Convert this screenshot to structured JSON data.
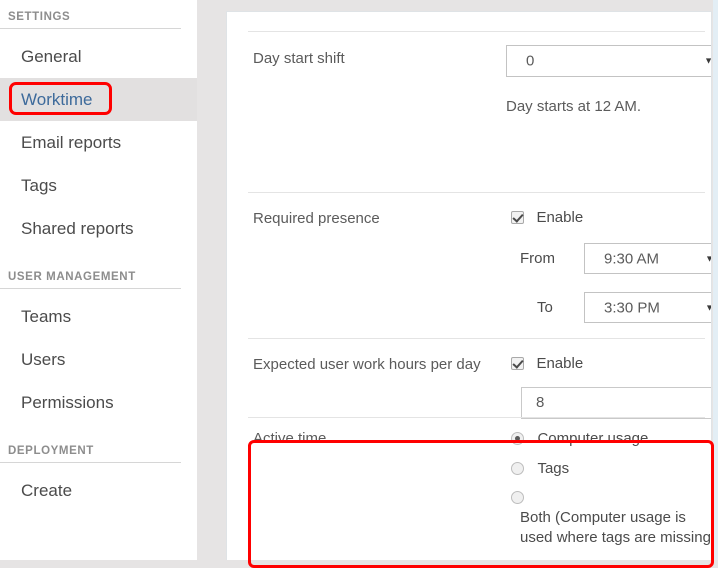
{
  "sidebar": {
    "groups": [
      {
        "title": "SETTINGS",
        "items": [
          {
            "label": "General",
            "active": false
          },
          {
            "label": "Worktime",
            "active": true
          },
          {
            "label": "Email reports",
            "active": false
          },
          {
            "label": "Tags",
            "active": false
          },
          {
            "label": "Shared reports",
            "active": false
          }
        ]
      },
      {
        "title": "USER MANAGEMENT",
        "items": [
          {
            "label": "Teams",
            "active": false
          },
          {
            "label": "Users",
            "active": false
          },
          {
            "label": "Permissions",
            "active": false
          }
        ]
      },
      {
        "title": "DEPLOYMENT",
        "items": [
          {
            "label": "Create",
            "active": false
          }
        ]
      }
    ]
  },
  "settings": {
    "day_start_shift": {
      "label": "Day start shift",
      "value": "0",
      "hint": "Day starts at 12 AM.",
      "dropdown_icon": "chevron-down-icon"
    },
    "required_presence": {
      "label": "Required presence",
      "enable_label": "Enable",
      "enabled": true,
      "from_label": "From",
      "from_value": "9:30 AM",
      "to_label": "To",
      "to_value": "3:30 PM",
      "dropdown_icon": "chevron-down-icon"
    },
    "expected_hours": {
      "label": "Expected user work hours per day",
      "enable_label": "Enable",
      "enabled": true,
      "value": "8"
    },
    "active_time": {
      "label": "Active time",
      "options": [
        {
          "label": "Computer usage",
          "selected": true
        },
        {
          "label": "Tags",
          "selected": false
        },
        {
          "label": "Both (Computer usage is used where tags are missing)",
          "selected": false
        }
      ]
    }
  },
  "annotations": {
    "highlight_color": "#ff0000",
    "worktime_box": "worktime-menu-highlight",
    "active_time_box": "active-time-section-highlight"
  }
}
